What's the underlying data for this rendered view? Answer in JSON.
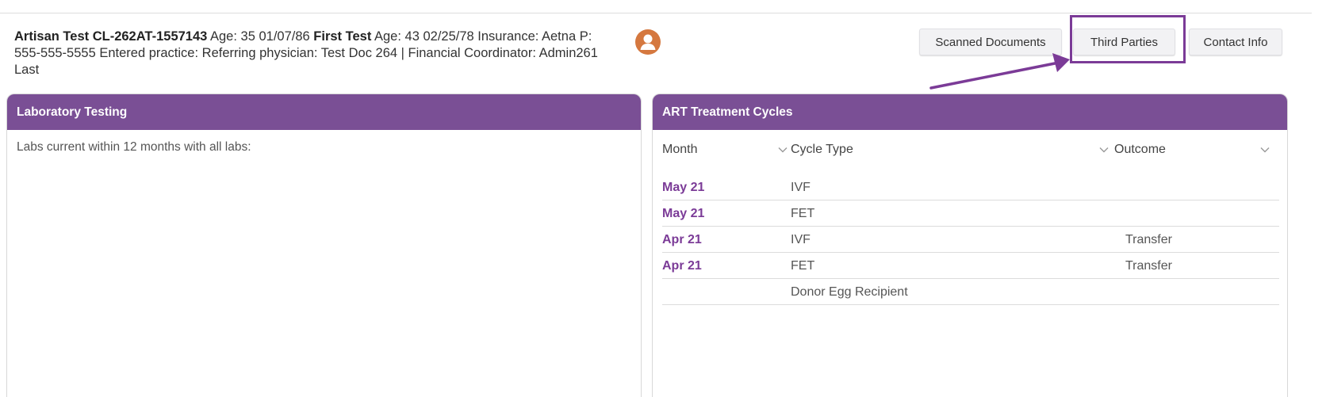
{
  "patient": {
    "name_id": "Artisan Test CL-262AT-1557143",
    "age_dob": " Age: 35 01/07/86 ",
    "partner_label": "First Test",
    "partner_age_insurance": " Age: 43 02/25/78 Insurance: Aetna P: 555-555-5555 Entered practice: Referring physician: Test Doc 264 | Financial Coordinator: Admin261 Last"
  },
  "avatar_icon": "user-icon",
  "buttons": {
    "scanned_documents": "Scanned Documents",
    "third_parties": "Third Parties",
    "contact_info": "Contact Info"
  },
  "lab_panel": {
    "title": "Laboratory Testing",
    "text": "Labs current within 12 months with all labs:"
  },
  "art_panel": {
    "title": "ART Treatment Cycles",
    "columns": [
      "Month",
      "Cycle Type",
      "Outcome"
    ],
    "rows": [
      {
        "month": "May 21",
        "cycle_type": "IVF",
        "outcome": ""
      },
      {
        "month": "May 21",
        "cycle_type": "FET",
        "outcome": ""
      },
      {
        "month": "Apr 21",
        "cycle_type": "IVF",
        "outcome": "Transfer"
      },
      {
        "month": "Apr 21",
        "cycle_type": "FET",
        "outcome": "Transfer"
      },
      {
        "month": "",
        "cycle_type": "Donor Egg Recipient",
        "outcome": ""
      }
    ]
  },
  "colors": {
    "brand_purple": "#7a4f95",
    "accent_purple": "#7b3b97",
    "avatar_orange": "#d5783f"
  }
}
